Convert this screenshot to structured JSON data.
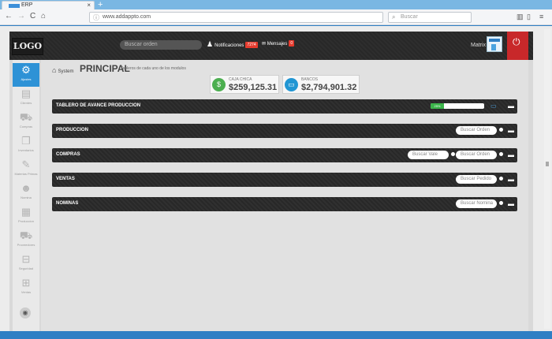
{
  "browser": {
    "tab_title": "ERP",
    "tab_close": "×",
    "new_tab": "+",
    "url": "www.addappto.com",
    "search_placeholder": "Buscar",
    "back": "←",
    "forward": "→",
    "reload": "C",
    "home": "⌂"
  },
  "header": {
    "logo": "LOGO",
    "search_placeholder": "Buscar orden",
    "notifications_label": "Notificaciones",
    "notifications_count": "7274",
    "messages_label": "Mensajes",
    "messages_count": "0",
    "user_name": "Matrix"
  },
  "sidebar": {
    "items": [
      {
        "label": "Ajustes",
        "icon": "⚙",
        "active": true
      },
      {
        "label": "Clientes",
        "icon": "▤",
        "active": false
      },
      {
        "label": "Compras",
        "icon": "⛟",
        "active": false
      },
      {
        "label": "Inventarios",
        "icon": "❐",
        "active": false
      },
      {
        "label": "Materias Primas",
        "icon": "✎",
        "active": false
      },
      {
        "label": "Nomina",
        "icon": "☻",
        "active": false
      },
      {
        "label": "Produccion",
        "icon": "▦",
        "active": false
      },
      {
        "label": "Proveedores",
        "icon": "⛟",
        "active": false
      },
      {
        "label": "Seguridad",
        "icon": "⊟",
        "active": false
      },
      {
        "label": "Ventas",
        "icon": "⊞",
        "active": false
      }
    ],
    "toggle": "◉"
  },
  "main": {
    "breadcrumb": "System",
    "title": "PRINCIPAL",
    "subtitle": "Tableros de cada uno de los modulos",
    "stats": [
      {
        "label": "CAJA CHICA",
        "value": "$259,125.31",
        "icon": "$",
        "color": "#4caf50"
      },
      {
        "label": "BANCOS",
        "value": "$2,794,901.32",
        "icon": "▭",
        "color": "#2196d3"
      }
    ],
    "panels": [
      {
        "title": "TABLERO DE AVANCE PRODUCCION",
        "progress_label": "25%",
        "progress": 0.25
      },
      {
        "title": "PRODUCCION",
        "search": [
          "Buscar Orden"
        ]
      },
      {
        "title": "COMPRAS",
        "search": [
          "Buscar Vale",
          "Buscar Orden"
        ]
      },
      {
        "title": "VENTAS",
        "search": [
          "Buscar Pedido"
        ]
      },
      {
        "title": "NOMINAS",
        "search": [
          "Buscar Nomina"
        ]
      }
    ]
  }
}
